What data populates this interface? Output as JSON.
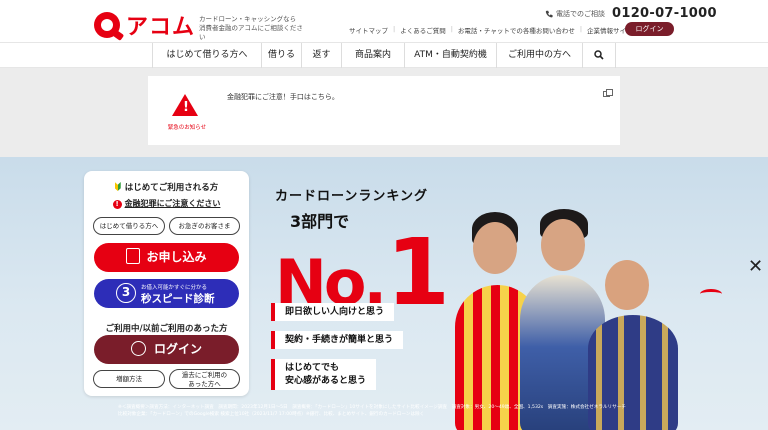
{
  "brand": {
    "logo_text": "アコム",
    "tagline_line1": "カードローン・キャッシングなら",
    "tagline_line2": "消費者金融のアコムにご相談ください",
    "accent_color": "#e60012",
    "dark_color": "#7a1d2a",
    "blue_color": "#2d2db8"
  },
  "header": {
    "phone_label": "電話でのご相談",
    "phone_number": "0120-07-1000",
    "util_links": [
      "サイトマップ",
      "よくあるご質問",
      "お電話・チャットでの各種お問い合わせ",
      "企業情報サイト"
    ],
    "login_label": "ログイン"
  },
  "nav": {
    "items": [
      "はじめて借りる方へ",
      "借りる",
      "返す",
      "商品案内",
      "ATM・自動契約機",
      "ご利用中の方へ"
    ],
    "search_icon": "search-icon"
  },
  "alert": {
    "label": "緊急のお知らせ",
    "message": "金融犯罪にご注意！手口はこちら。",
    "icon": "warning-triangle-icon"
  },
  "panel": {
    "title": "はじめてご利用される方",
    "fraud_link": "金融犯罪にご注意ください",
    "btn_first": "はじめて借りる方へ",
    "btn_urgent": "お急ぎのお客さま",
    "apply_label": "お申し込み",
    "speed_small": "お借入可能かすぐに分かる",
    "speed_num": "3",
    "speed_label": "秒スピード診断",
    "member_title": "ご利用中/以前ご利用のあった方",
    "member_login": "ログイン",
    "btn_repay": "増額方法",
    "btn_past_line1": "過去にご利用の",
    "btn_past_line2": "あった方へ"
  },
  "hero": {
    "ranking": "カードローンランキング",
    "categories": "3部門で",
    "no": "No.",
    "one": "1",
    "points": [
      {
        "line1": "即日欲しい人向けと思う",
        "line2": ""
      },
      {
        "line1": "契約・手続きが簡単と思う",
        "line2": ""
      },
      {
        "line1": "はじめてでも",
        "line2": "安心感があると思う"
      }
    ],
    "footnote_line1": "※＜調査概要＞調査方法：インターネット調査　調査期間：2023年12月1日〜5日　調査概要：「カードローン」10サイトを対象にしたサイト比較イメージ調査　調査対象：男女、20〜49歳、全国、1,532s　調査実施：株式会社ゼネラルリサーチ",
    "footnote_line2": "比較対象企業：「カードローン」でのGoogle検索 検索上位10社（2023/11/7 17:00時点）※銀行、比較、まとめサイト、銀行のカードローンは除く"
  }
}
